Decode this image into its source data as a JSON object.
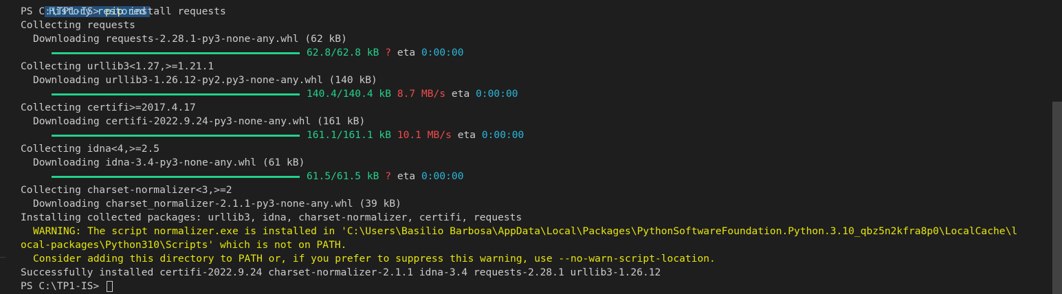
{
  "banner": "History restored",
  "prompt1": {
    "prefix": "PS C:\\TP1-IS> ",
    "cmd": "pip",
    "args": " install requests"
  },
  "lines": {
    "c1": "Collecting requests",
    "d1": "Downloading requests-2.28.1-py3-none-any.whl (62 kB)",
    "c2": "Collecting urllib3<1.27,>=1.21.1",
    "d2": "Downloading urllib3-1.26.12-py2.py3-none-any.whl (140 kB)",
    "c3": "Collecting certifi>=2017.4.17",
    "d3": "Downloading certifi-2022.9.24-py3-none-any.whl (161 kB)",
    "c4": "Collecting idna<4,>=2.5",
    "d4": "Downloading idna-3.4-py3-none-any.whl (61 kB)",
    "c5": "Collecting charset-normalizer<3,>=2",
    "d5": "Downloading charset_normalizer-2.1.1-py3-none-any.whl (39 kB)",
    "installing": "Installing collected packages: urllib3, idna, charset-normalizer, certifi, requests",
    "warn1": "WARNING: The script normalizer.exe is installed in 'C:\\Users\\Basilio Barbosa\\AppData\\Local\\Packages\\PythonSoftwareFoundation.Python.3.10_qbz5n2kfra8p0\\LocalCache\\l",
    "warn2": "ocal-packages\\Python310\\Scripts' which is not on PATH.",
    "warn3": "Consider adding this directory to PATH or, if you prefer to suppress this warning, use --no-warn-script-location.",
    "success": "Successfully installed certifi-2022.9.24 charset-normalizer-2.1.1 idna-3.4 requests-2.28.1 urllib3-1.26.12"
  },
  "progress": [
    {
      "size": "62.8/62.8 kB",
      "speed": "?",
      "eta_label": "eta",
      "eta": "0:00:00",
      "fraction": 1.0
    },
    {
      "size": "140.4/140.4 kB",
      "speed": "8.7 MB/s",
      "eta_label": "eta",
      "eta": "0:00:00",
      "fraction": 1.0
    },
    {
      "size": "161.1/161.1 kB",
      "speed": "10.1 MB/s",
      "eta_label": "eta",
      "eta": "0:00:00",
      "fraction": 1.0
    },
    {
      "size": "61.5/61.5 kB",
      "speed": "?",
      "eta_label": "eta",
      "eta": "0:00:00",
      "fraction": 1.0
    }
  ],
  "prompt2": "PS C:\\TP1-IS> ",
  "colors": {
    "background": "#1e1e1e",
    "text": "#cccccc",
    "green": "#23d18b",
    "red": "#f14c4c",
    "cyan": "#29b8db",
    "yellow": "#e5e510"
  }
}
